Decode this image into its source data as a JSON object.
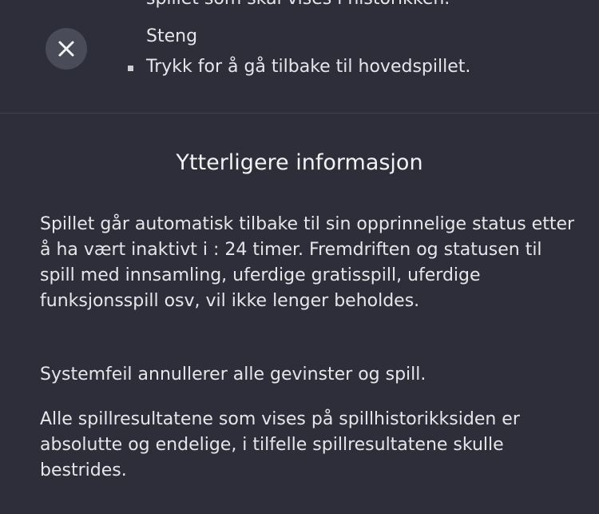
{
  "top_section": {
    "cutoff_text": "spillet som skal vises i historikken.",
    "close_item": {
      "title": "Steng",
      "description": "Trykk for å gå tilbake til hovedspillet."
    }
  },
  "info": {
    "title": "Ytterligere informasjon",
    "paragraphs": [
      "Spillet går automatisk tilbake til sin opprinnelige status etter å ha vært inaktivt i : 24 timer. Fremdriften og statusen til spill med innsamling, uferdige gratisspill, uferdige funksjonsspill osv, vil ikke lenger beholdes.",
      "Systemfeil annullerer alle gevinster og spill.",
      "Alle spillresultatene som vises på spillhistorikksiden er absolutte og endelige, i tilfelle spillresultatene skulle bestrides."
    ]
  },
  "icons": {
    "close": "close-icon"
  },
  "colors": {
    "background": "#2d2e3a",
    "icon_circle": "#4a4b58",
    "text": "#e6e6ea",
    "divider": "#3e3f4c"
  }
}
